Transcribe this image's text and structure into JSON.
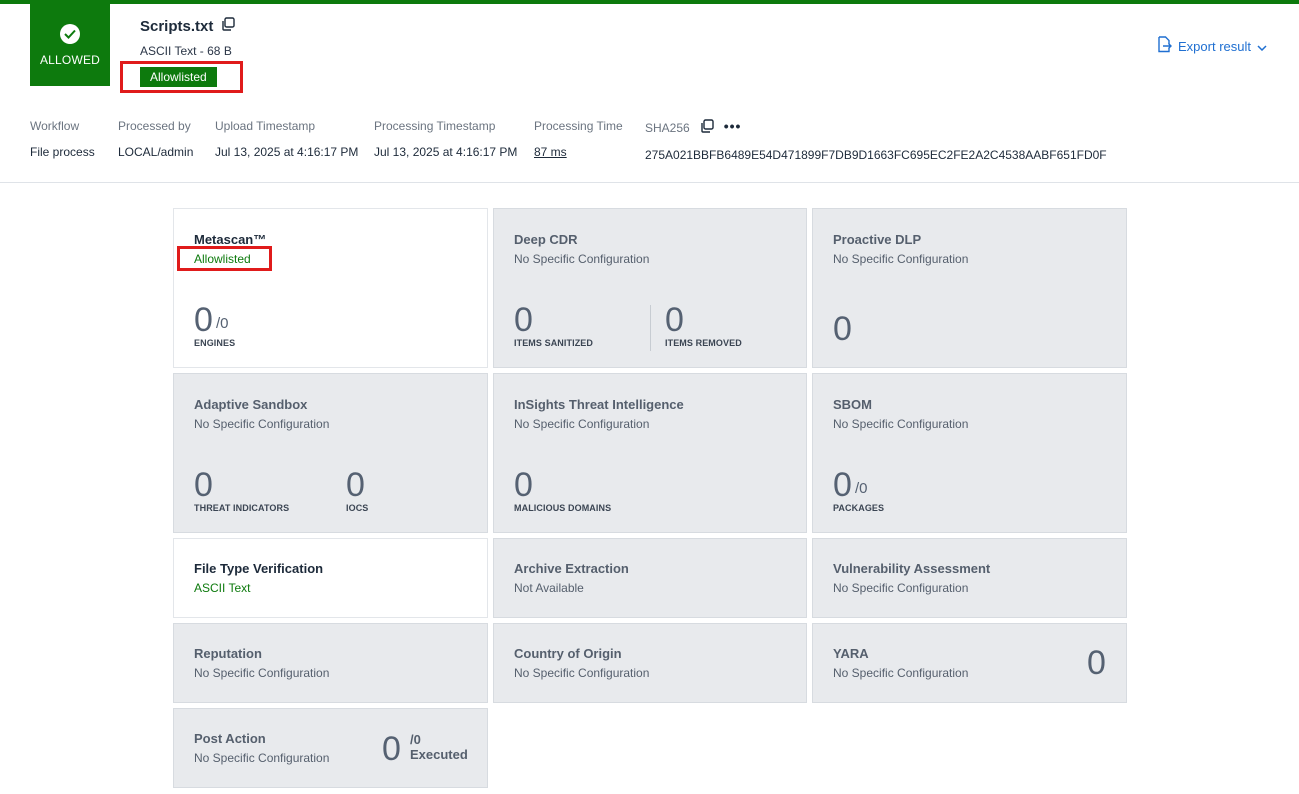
{
  "verdict": {
    "label": "ALLOWED"
  },
  "file": {
    "name": "Scripts.txt",
    "type_size": "ASCII Text - 68 B",
    "badge": "Allowlisted"
  },
  "export": {
    "label": "Export result"
  },
  "meta": {
    "workflow": {
      "label": "Workflow",
      "value": "File process"
    },
    "processed_by": {
      "label": "Processed by",
      "value": "LOCAL/admin"
    },
    "upload": {
      "label": "Upload Timestamp",
      "value": "Jul 13, 2025 at 4:16:17 PM"
    },
    "processing_ts": {
      "label": "Processing Timestamp",
      "value": "Jul 13, 2025 at 4:16:17 PM"
    },
    "processing_time": {
      "label": "Processing Time",
      "value": "87 ms"
    },
    "sha": {
      "label": "SHA256",
      "value": "275A021BBFB6489E54D471899F7DB9D1663FC695EC2FE2A2C4538AABF651FD0F",
      "more": "•••"
    }
  },
  "cards": {
    "metascan": {
      "title": "Metascan™",
      "status": "Allowlisted",
      "count": "0",
      "total": "/0",
      "caption": "ENGINES"
    },
    "deep_cdr": {
      "title": "Deep CDR",
      "sub": "No Specific Configuration",
      "sanitized": "0",
      "sanitized_label": "ITEMS SANITIZED",
      "removed": "0",
      "removed_label": "ITEMS REMOVED"
    },
    "dlp": {
      "title": "Proactive DLP",
      "sub": "No Specific Configuration",
      "count": "0"
    },
    "sandbox": {
      "title": "Adaptive Sandbox",
      "sub": "No Specific Configuration",
      "threat": "0",
      "threat_label": "THREAT INDICATORS",
      "iocs": "0",
      "iocs_label": "IOCS"
    },
    "insights": {
      "title": "InSights Threat Intelligence",
      "sub": "No Specific Configuration",
      "count": "0",
      "caption": "MALICIOUS DOMAINS"
    },
    "sbom": {
      "title": "SBOM",
      "sub": "No Specific Configuration",
      "count": "0",
      "total": "/0",
      "caption": "PACKAGES"
    },
    "ftv": {
      "title": "File Type Verification",
      "sub": "ASCII Text"
    },
    "archive": {
      "title": "Archive Extraction",
      "sub": "Not Available"
    },
    "vuln": {
      "title": "Vulnerability Assessment",
      "sub": "No Specific Configuration"
    },
    "reputation": {
      "title": "Reputation",
      "sub": "No Specific Configuration"
    },
    "country": {
      "title": "Country of Origin",
      "sub": "No Specific Configuration"
    },
    "yara": {
      "title": "YARA",
      "sub": "No Specific Configuration",
      "count": "0"
    },
    "post_action": {
      "title": "Post Action",
      "sub": "No Specific Configuration",
      "count": "0",
      "total": "/0",
      "executed": "Executed"
    }
  },
  "colors": {
    "allowed_green": "#0d7a0d",
    "highlight_red": "#e01b1b",
    "link_blue": "#1f6fd1"
  }
}
